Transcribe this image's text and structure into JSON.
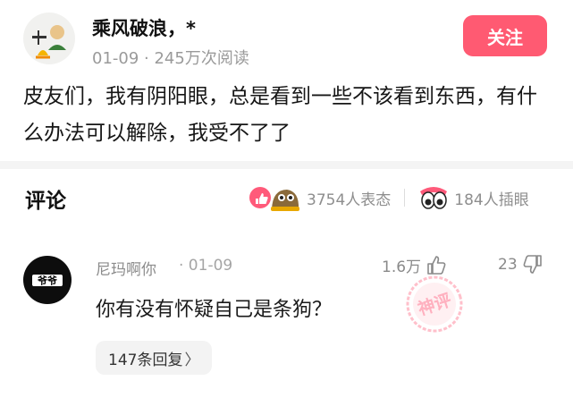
{
  "post": {
    "author": "乘风破浪，*",
    "date": "01-09",
    "views": "245万次阅读",
    "follow_label": "关注",
    "text": "皮友们，我有阴阳眼，总是看到一些不该看到东西，有什么办法可以解除，我受不了了"
  },
  "comments_section": {
    "title": "评论",
    "reactions_text": "3754人表态",
    "pics_text": "184人插眼"
  },
  "comment": {
    "username": "尼玛啊你",
    "date": "· 01-09",
    "likes": "1.6万",
    "dislikes": "23",
    "text": "你有没有怀疑自己是条狗？",
    "avatar_text": "爷爷",
    "stamp_text": "神评",
    "replies_label": "147条回复",
    "replies_chevron": "〉"
  },
  "colors": {
    "accent": "#ff5a72",
    "muted": "#9a9a9a"
  }
}
